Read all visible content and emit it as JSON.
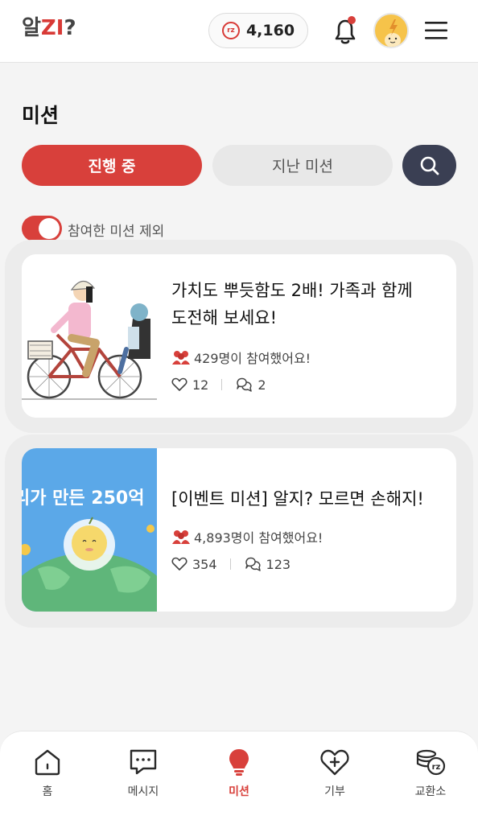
{
  "header": {
    "logo_a": "알",
    "logo_z": "ZI",
    "logo_q": "?",
    "coin_label": "rz",
    "points": "4,160"
  },
  "page": {
    "title": "미션"
  },
  "tabs": {
    "active": "진행 중",
    "inactive": "지난 미션"
  },
  "filter": {
    "label": "참여한 미션 제외",
    "enabled": true
  },
  "missions": [
    {
      "title_line1": "가치도 뿌듯함도 2배! 가족과 함께",
      "title_line2": "도전해 보세요!",
      "participants": "429명이 참여했어요!",
      "likes": "12",
      "comments": "2"
    },
    {
      "title_line1": "[이벤트 미션] 알지? 모르면 손해지!",
      "banner_text": "리가 만든 250억",
      "participants": "4,893명이 참여했어요!",
      "likes": "354",
      "comments": "123"
    }
  ],
  "nav": {
    "items": [
      {
        "label": "홈",
        "icon": "home-icon"
      },
      {
        "label": "메시지",
        "icon": "message-icon"
      },
      {
        "label": "미션",
        "icon": "lightbulb-icon",
        "active": true
      },
      {
        "label": "기부",
        "icon": "heart-plus-icon"
      },
      {
        "label": "교환소",
        "icon": "coin-stack-icon"
      }
    ]
  },
  "colors": {
    "accent": "#d8403b",
    "search_bg": "#3a3f53",
    "nav_active": "#d8403b"
  }
}
